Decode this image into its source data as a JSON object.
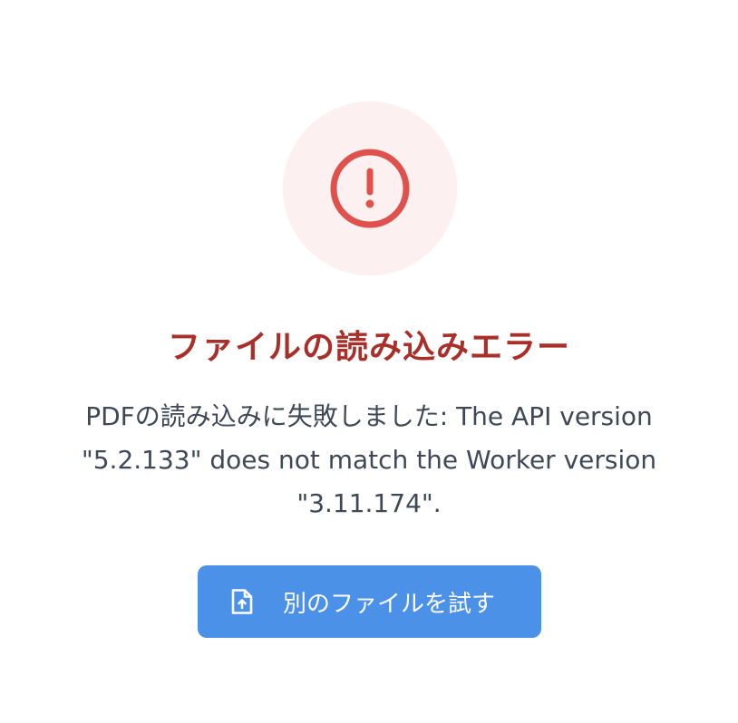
{
  "error": {
    "icon": "exclamation-circle-icon",
    "title": "ファイルの読み込みエラー",
    "message": "PDFの読み込みに失敗しました: The API version \"5.2.133\" does not match the Worker version \"3.11.174\"."
  },
  "retry_button": {
    "icon": "file-upload-icon",
    "label": "別のファイルを試す"
  },
  "colors": {
    "accent_red": "#e0514d",
    "title_red": "#a9302a",
    "icon_bg": "#fcf1f0",
    "button_blue": "#4b91e8",
    "text": "#3f4856"
  }
}
